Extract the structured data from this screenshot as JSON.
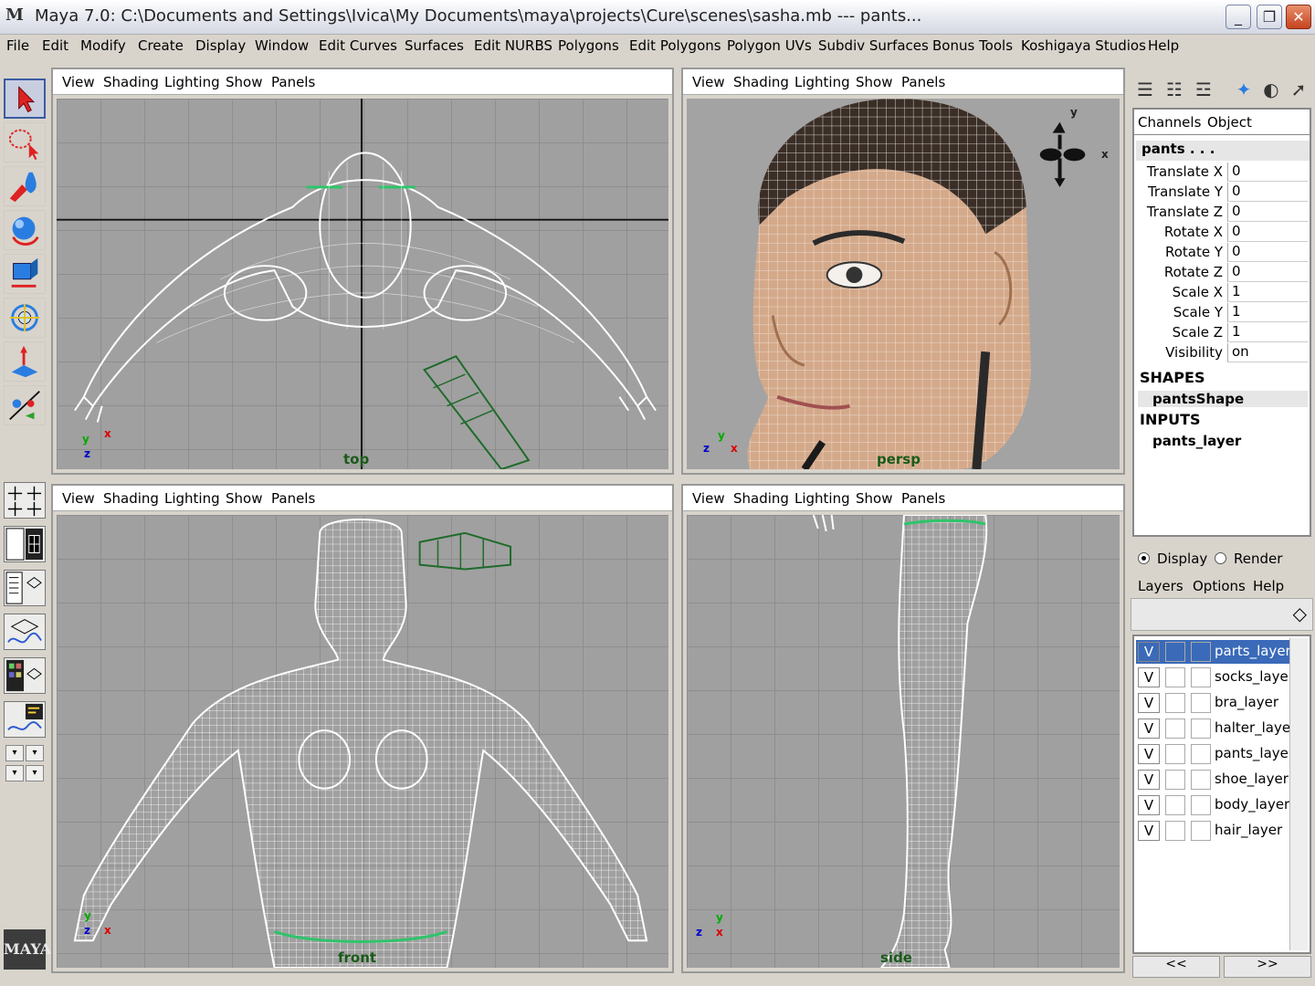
{
  "window": {
    "title": "Maya 7.0: C:\\Documents and Settings\\Ivica\\My Documents\\maya\\projects\\Cure\\scenes\\sasha.mb   ---   pants...",
    "app_icon": "M",
    "controls": {
      "minimize": "_",
      "maximize": "❐",
      "close": "✕"
    }
  },
  "menubar": [
    "File",
    "Edit",
    "Modify",
    "Create",
    "Display",
    "Window",
    "Edit Curves",
    "Surfaces",
    "Edit NURBS",
    "Polygons",
    "Edit Polygons",
    "Polygon UVs",
    "Subdiv Surfaces",
    "Bonus Tools",
    "Koshigaya Studios",
    "Help"
  ],
  "viewport_menu": [
    "View",
    "Shading",
    "Lighting",
    "Show",
    "Panels"
  ],
  "viewports": {
    "top": {
      "label": "top"
    },
    "persp": {
      "label": "persp"
    },
    "front": {
      "label": "front"
    },
    "side": {
      "label": "side"
    }
  },
  "axes": {
    "x": "x",
    "y": "y",
    "z": "z"
  },
  "tools": [
    "select-tool",
    "lasso-tool",
    "paint-select-tool",
    "move-tool",
    "rotate-tool",
    "scale-tool",
    "show-manipulator-tool",
    "last-used-tool"
  ],
  "channel_box": {
    "tabs": [
      "Channels",
      "Object"
    ],
    "object_name": "pants . . .",
    "attributes": [
      {
        "name": "Translate X",
        "value": "0"
      },
      {
        "name": "Translate Y",
        "value": "0"
      },
      {
        "name": "Translate Z",
        "value": "0"
      },
      {
        "name": "Rotate X",
        "value": "0"
      },
      {
        "name": "Rotate Y",
        "value": "0"
      },
      {
        "name": "Rotate Z",
        "value": "0"
      },
      {
        "name": "Scale X",
        "value": "1"
      },
      {
        "name": "Scale Y",
        "value": "1"
      },
      {
        "name": "Scale Z",
        "value": "1"
      },
      {
        "name": "Visibility",
        "value": "on"
      }
    ],
    "shapes_header": "SHAPES",
    "shape_name": "pantsShape",
    "inputs_header": "INPUTS",
    "input_name": "pants_layer"
  },
  "layer_editor": {
    "display_label": "Display",
    "render_label": "Render",
    "menu": [
      "Layers",
      "Options",
      "Help"
    ],
    "visible_mark": "V",
    "layers": [
      "parts_layer",
      "socks_layer",
      "bra_layer",
      "halter_layer",
      "pants_layer",
      "shoe_layer",
      "body_layer",
      "hair_layer"
    ],
    "nav_prev": "<<",
    "nav_next": ">>"
  },
  "logo_text": "MAYA",
  "colors": {
    "selection": "#3a6ab8",
    "wireframe": "#ffffff",
    "viewport_bg": "#a0a0a0",
    "skin": "#d4a98a",
    "hair": "#3a2e26",
    "camera_label": "#1a5a1a"
  }
}
